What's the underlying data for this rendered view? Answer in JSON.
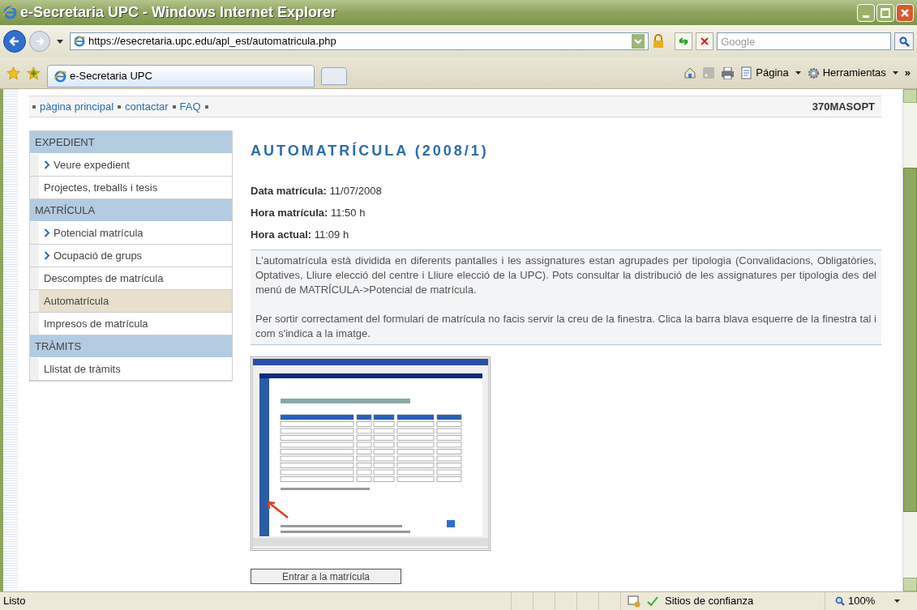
{
  "window": {
    "title": "e-Secretaria UPC - Windows Internet Explorer"
  },
  "address_bar": {
    "url": "https://esecretaria.upc.edu/apl_est/automatricula.php"
  },
  "search": {
    "placeholder": "Google"
  },
  "tabs": [
    {
      "label": "e-Secretaria UPC",
      "selected": true
    }
  ],
  "command_bar": {
    "page": "Página",
    "tools": "Herramientas",
    "more": "»"
  },
  "top_nav": {
    "links": [
      "pàgina principal",
      "contactar",
      "FAQ"
    ],
    "user_code": "370MASOPT"
  },
  "sidebar": {
    "items": [
      {
        "kind": "header",
        "label": "EXPEDIENT"
      },
      {
        "kind": "link",
        "label": "Veure expedient",
        "selected": false
      },
      {
        "kind": "item",
        "label": "Projectes, treballs i tesis",
        "selected": false
      },
      {
        "kind": "header",
        "label": "MATRÍCULA"
      },
      {
        "kind": "link",
        "label": "Potencial matrícula",
        "selected": false
      },
      {
        "kind": "link",
        "label": "Ocupació de grups",
        "selected": false
      },
      {
        "kind": "item",
        "label": "Descomptes de matrícula",
        "selected": false
      },
      {
        "kind": "item",
        "label": "Automatrícula",
        "selected": true
      },
      {
        "kind": "item",
        "label": "Impresos de matrícula",
        "selected": false
      },
      {
        "kind": "header",
        "label": "TRÀMITS"
      },
      {
        "kind": "item",
        "label": "Llistat de tràmits",
        "selected": false
      }
    ]
  },
  "main": {
    "heading": "AUTOMATRÍCULA (2008/1)",
    "fields": [
      {
        "label": "Data matrícula:",
        "value": "11/07/2008"
      },
      {
        "label": "Hora matrícula:",
        "value": "11:50 h"
      },
      {
        "label": "Hora actual:",
        "value": "11:09 h"
      }
    ],
    "notice": [
      "L'automatrícula està dividida en diferents pantalles i les assignatures estan agrupades per tipologia (Convalidacions, Obligatòries, Optatives, Lliure elecció del centre i Lliure elecció de la UPC). Pots consultar la distribució de les assignatures per tipologia des del menú de MATRÍCULA->Potencial de matrícula.",
      "Per sortir correctament del formulari de matrícula no facis servir la creu de la finestra. Clica la barra blava esquerre de la finestra tal i com s'indica a la imatge."
    ],
    "button": "Entrar a la matrícula"
  },
  "status_bar": {
    "text": "Listo",
    "zone": "Sitios de confianza",
    "zoom": "100%"
  }
}
